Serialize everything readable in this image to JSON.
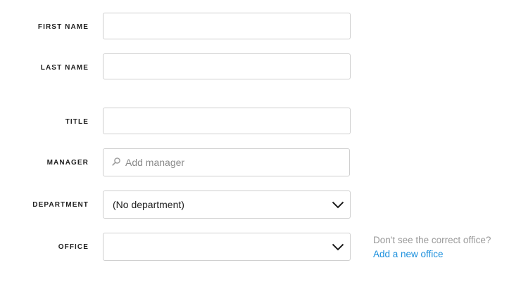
{
  "form": {
    "first_name": {
      "label": "FIRST NAME",
      "value": ""
    },
    "last_name": {
      "label": "LAST NAME",
      "value": ""
    },
    "title": {
      "label": "TITLE",
      "value": ""
    },
    "manager": {
      "label": "MANAGER",
      "placeholder": "Add manager",
      "icon": "search-icon"
    },
    "department": {
      "label": "DEPARTMENT",
      "selected": "(No department)",
      "icon": "chevron-down-icon"
    },
    "office": {
      "label": "OFFICE",
      "selected": "",
      "icon": "chevron-down-icon",
      "hint": "Don't see the correct office?",
      "add_link": "Add a new office"
    }
  },
  "colors": {
    "link": "#1a8fdd",
    "hint": "#9a9a9a",
    "border": "#cfcfcf",
    "label": "#1f1f1f"
  }
}
